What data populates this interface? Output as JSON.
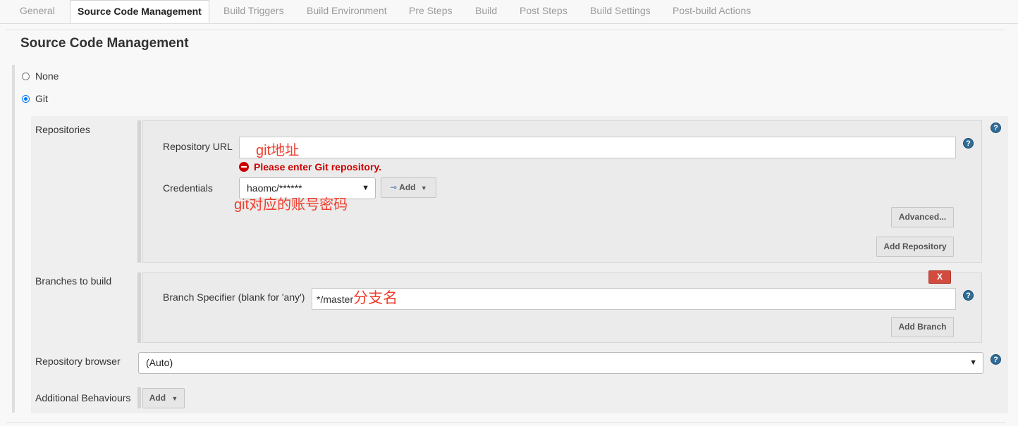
{
  "tabs": [
    {
      "label": "General"
    },
    {
      "label": "Source Code Management"
    },
    {
      "label": "Build Triggers"
    },
    {
      "label": "Build Environment"
    },
    {
      "label": "Pre Steps"
    },
    {
      "label": "Build"
    },
    {
      "label": "Post Steps"
    },
    {
      "label": "Build Settings"
    },
    {
      "label": "Post-build Actions"
    }
  ],
  "active_tab": "Source Code Management",
  "section": {
    "title": "Source Code Management"
  },
  "scm": {
    "options": [
      {
        "label": "None",
        "selected": false
      },
      {
        "label": "Git",
        "selected": true
      }
    ]
  },
  "repositories": {
    "label": "Repositories",
    "url_label": "Repository URL",
    "url_value": "",
    "url_annotation": "git地址",
    "error": "Please enter Git repository.",
    "credentials_label": "Credentials",
    "credentials_value": "haomc/******",
    "credentials_annotation": "git对应的账号密码",
    "add_label": "Add",
    "advanced_label": "Advanced...",
    "add_repository_label": "Add Repository"
  },
  "branches": {
    "label": "Branches to build",
    "specifier_label": "Branch Specifier (blank for 'any')",
    "specifier_value": "*/master",
    "specifier_annotation": "分支名",
    "delete_label": "X",
    "add_branch_label": "Add Branch"
  },
  "browser": {
    "label": "Repository browser",
    "value": "(Auto)"
  },
  "behaviours": {
    "label": "Additional Behaviours",
    "add_label": "Add"
  },
  "help_glyph": "?",
  "colors": {
    "annotation": "#f03c2c",
    "error": "#cc0000",
    "delete": "#d24b3e",
    "help": "#2f6c96"
  }
}
